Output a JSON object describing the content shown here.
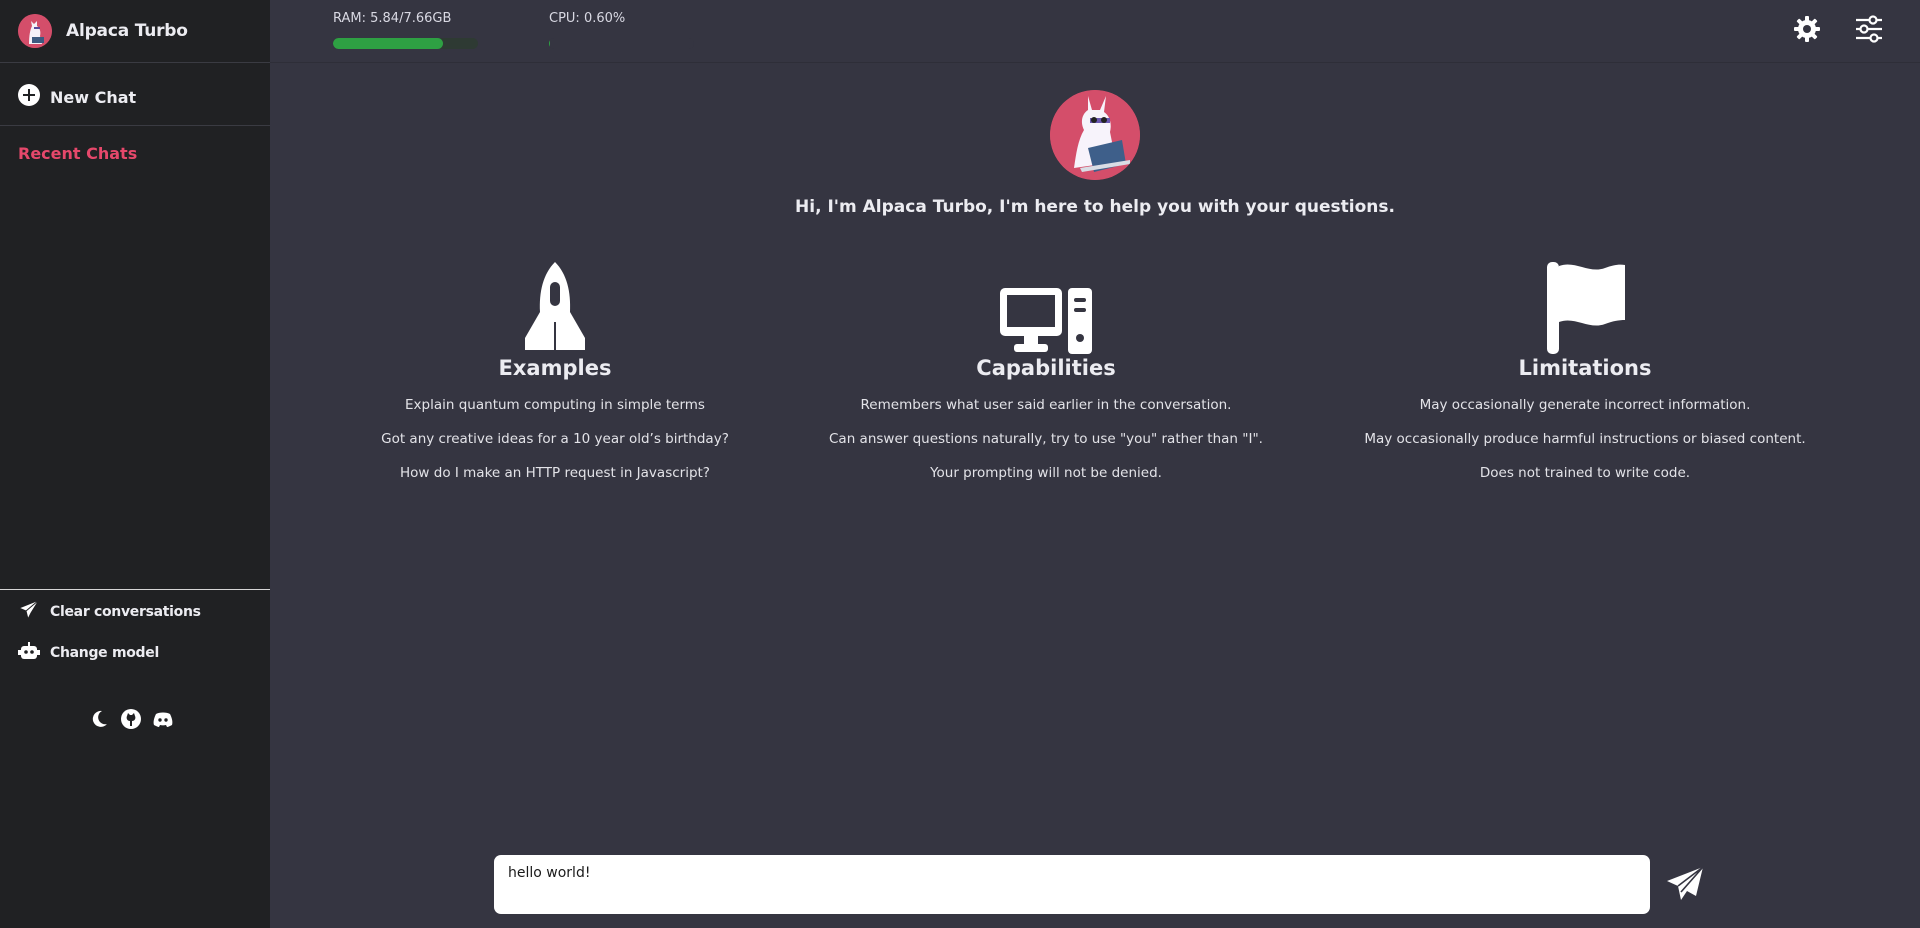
{
  "app": {
    "title": "Alpaca Turbo"
  },
  "sidebar": {
    "new_chat_label": "New Chat",
    "recent_title": "Recent Chats",
    "actions": [
      {
        "label": "Clear conversations",
        "icon": "paper-plane-icon"
      },
      {
        "label": "Change model",
        "icon": "robot-icon"
      }
    ],
    "social_icons": [
      "moon-icon",
      "github-icon",
      "discord-icon"
    ]
  },
  "topbar": {
    "ram_label": "RAM: 5.84/7.66GB",
    "ram_fraction": 0.762,
    "cpu_label": "CPU: 0.60%",
    "cpu_fraction": 0.006,
    "icons": [
      "gear-icon",
      "sliders-icon"
    ]
  },
  "main": {
    "greeting": "Hi, I'm Alpaca Turbo, I'm here to help you with your questions.",
    "columns": [
      {
        "title": "Examples",
        "icon": "rocket-icon",
        "items": [
          "Explain quantum computing in simple terms",
          "Got any creative ideas for a 10 year old’s birthday?",
          "How do I make an HTTP request in Javascript?"
        ]
      },
      {
        "title": "Capabilities",
        "icon": "computer-icon",
        "items": [
          "Remembers what user said earlier in the conversation.",
          "Can answer questions naturally, try to use \"you\" rather than \"I\".",
          "Your prompting will not be denied."
        ]
      },
      {
        "title": "Limitations",
        "icon": "flag-icon",
        "items": [
          "May occasionally generate incorrect information.",
          "May occasionally produce harmful instructions or biased content.",
          "Does not trained to write code."
        ]
      }
    ]
  },
  "input": {
    "value": "hello world!"
  },
  "colors": {
    "accent": "#e6486b",
    "sidebar_bg": "#202123",
    "main_bg": "#353541",
    "progress": "#2ea043"
  }
}
